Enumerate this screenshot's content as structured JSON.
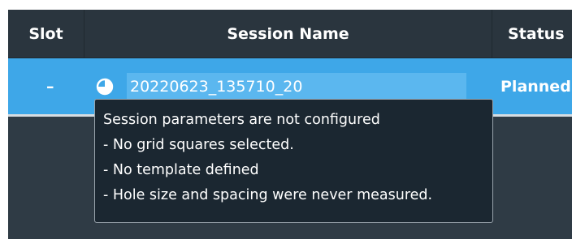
{
  "table": {
    "columns": {
      "slot": "Slot",
      "session_name": "Session Name",
      "status": "Status"
    },
    "rows": [
      {
        "slot": "–",
        "status_icon": "half-filled-circle-icon",
        "session_name": "20220623_135710_20",
        "status": "Planned"
      }
    ]
  },
  "tooltip": {
    "lines": [
      "Session parameters are not configured",
      "- No grid squares selected.",
      "- No template defined",
      "- Hole size and spacing were never measured."
    ]
  },
  "colors": {
    "panel_bg": "#2f3b45",
    "header_bg": "#2a353e",
    "selected_row": "#3ea7e8",
    "tooltip_bg": "#1b2731"
  }
}
